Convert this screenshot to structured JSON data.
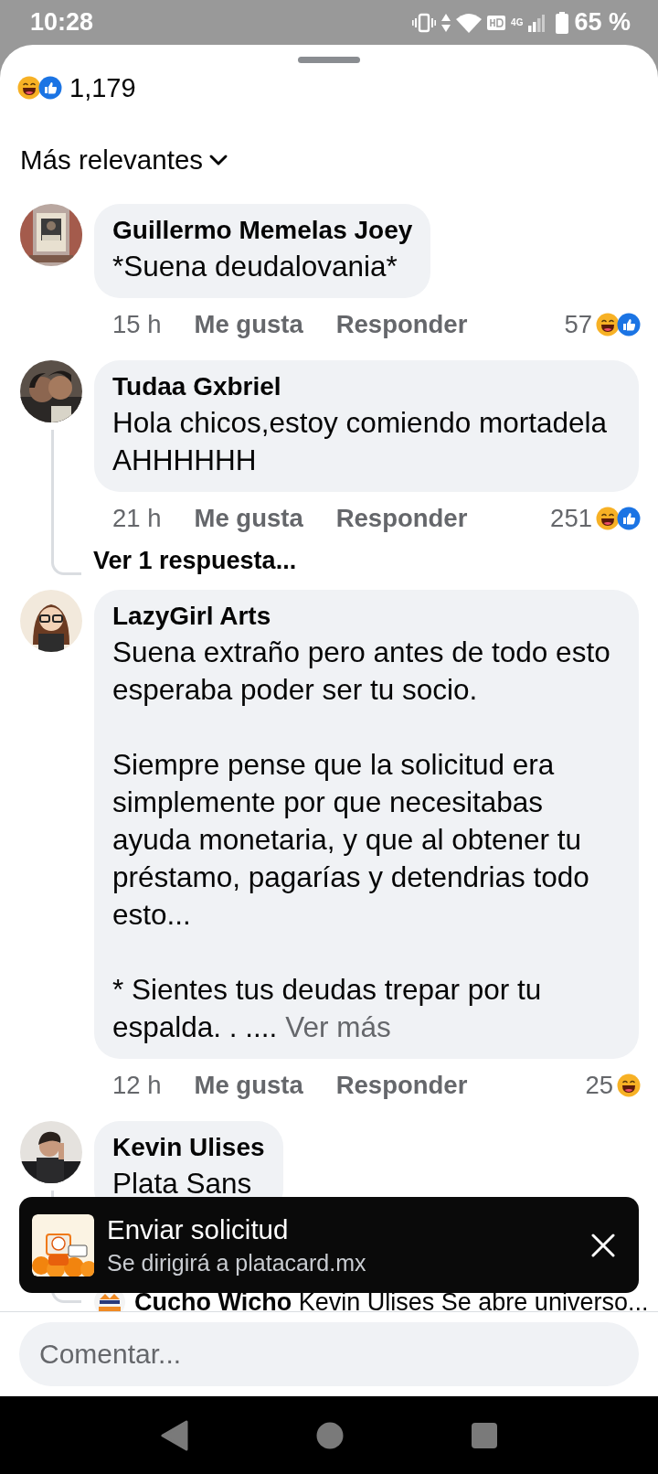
{
  "status_bar": {
    "time": "10:28",
    "battery": "65 %",
    "network": "4G"
  },
  "reactions_summary": {
    "reactions": [
      {
        "kind": "haha"
      },
      {
        "kind": "like"
      }
    ],
    "count": "1,179"
  },
  "sort": {
    "label": "Más relevantes"
  },
  "comments": [
    {
      "author": "Guillermo Memelas Joey",
      "paragraphs": [
        "*Suena deudalovania*"
      ],
      "time": "15 h",
      "like": "Me gusta",
      "reply": "Responder",
      "reaction_count": "57",
      "reactions": [
        {
          "kind": "haha"
        },
        {
          "kind": "like"
        }
      ],
      "thread": false
    },
    {
      "author": "Tudaa Gxbriel",
      "paragraphs": [
        "Hola chicos,estoy comiendo mortadela AHHHHHH"
      ],
      "time": "21 h",
      "like": "Me gusta",
      "reply": "Responder",
      "reaction_count": "251",
      "reactions": [
        {
          "kind": "haha"
        },
        {
          "kind": "like"
        }
      ],
      "thread": true,
      "replies_link": "Ver 1 respuesta..."
    },
    {
      "author": "LazyGirl Arts",
      "paragraphs": [
        "Suena extraño pero antes de todo esto esperaba poder ser tu socio.",
        "Siempre pense que la solicitud era simplemente por que necesitabas ayuda monetaria, y que al obtener tu préstamo, pagarías y detendrias todo esto...",
        "* Sientes tus deudas trepar por tu espalda. . ...."
      ],
      "see_more": "Ver más",
      "time": "12 h",
      "like": "Me gusta",
      "reply": "Responder",
      "reaction_count": "25",
      "reactions": [
        {
          "kind": "haha"
        }
      ],
      "thread": false
    },
    {
      "author": "Kevin Ulises",
      "paragraphs": [
        "Plata Sans"
      ],
      "thread": true,
      "reply_preview": {
        "author": "Cucho Wicho",
        "text": "Kevin Ulises Se abre universo..."
      }
    }
  ],
  "toast": {
    "kind": "picture",
    "title": "Enviar solicitud",
    "subtitle": "Se dirigirá a platacard.mx"
  },
  "comment_field": {
    "placeholder": "Comentar..."
  }
}
